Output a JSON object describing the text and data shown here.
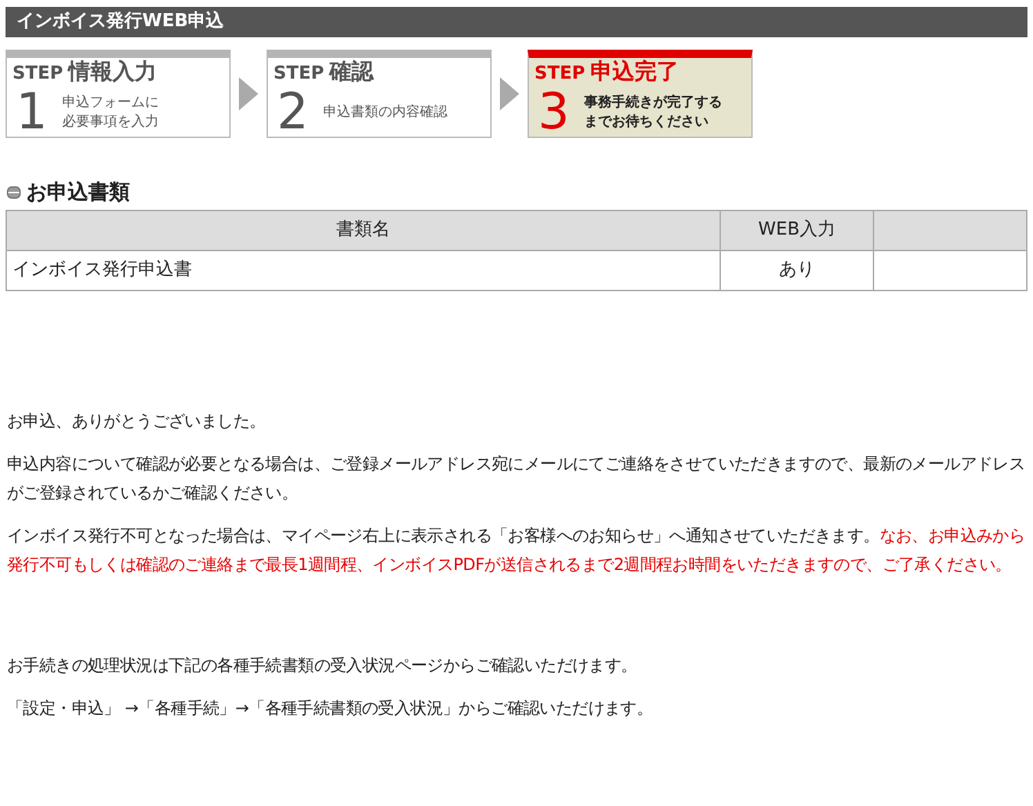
{
  "header": {
    "title": "インボイス発行WEB申込"
  },
  "steps": [
    {
      "prefix": "STEP",
      "title": "情報入力",
      "number": "1",
      "lines": [
        "申込フォームに",
        "必要事項を入力"
      ],
      "selected": false
    },
    {
      "prefix": "STEP",
      "title": "確認",
      "number": "2",
      "lines": [
        "申込書類の内容確認"
      ],
      "selected": false
    },
    {
      "prefix": "STEP",
      "title": "申込完了",
      "number": "3",
      "lines": [
        "事務手続きが完了する",
        "までお待ちください"
      ],
      "selected": true
    }
  ],
  "section": {
    "title": "お申込書類"
  },
  "table": {
    "columns": [
      "書類名",
      "WEB入力",
      ""
    ],
    "rows": [
      [
        "インボイス発行申込書",
        "あり",
        ""
      ]
    ]
  },
  "message_groups": [
    [
      {
        "segments": [
          {
            "text": "お申込、ありがとうございました。",
            "emphasis": false
          }
        ]
      },
      {
        "segments": [
          {
            "text": "申込内容について確認が必要となる場合は、ご登録メールアドレス宛にメールにてご連絡をさせていただきますので、最新のメールアドレスがご登録されているかご確認ください。",
            "emphasis": false
          }
        ]
      },
      {
        "segments": [
          {
            "text": "インボイス発行不可となった場合は、マイページ右上に表示される「お客様へのお知らせ」へ通知させていただきます。",
            "emphasis": false
          },
          {
            "text": "なお、お申込みから発行不可もしくは確認のご連絡まで最長1週間程、インボイスPDFが送信されるまで2週間程お時間をいただきますので、ご了承ください。",
            "emphasis": true
          }
        ]
      }
    ],
    [
      {
        "segments": [
          {
            "text": "お手続きの処理状況は下記の各種手続書類の受入状況ページからご確認いただけます。",
            "emphasis": false
          }
        ]
      },
      {
        "segments": [
          {
            "text": "「設定・申込」 →「各種手続」→「各種手続書類の受入状況」からご確認いただけます。",
            "emphasis": false
          }
        ]
      }
    ]
  ]
}
